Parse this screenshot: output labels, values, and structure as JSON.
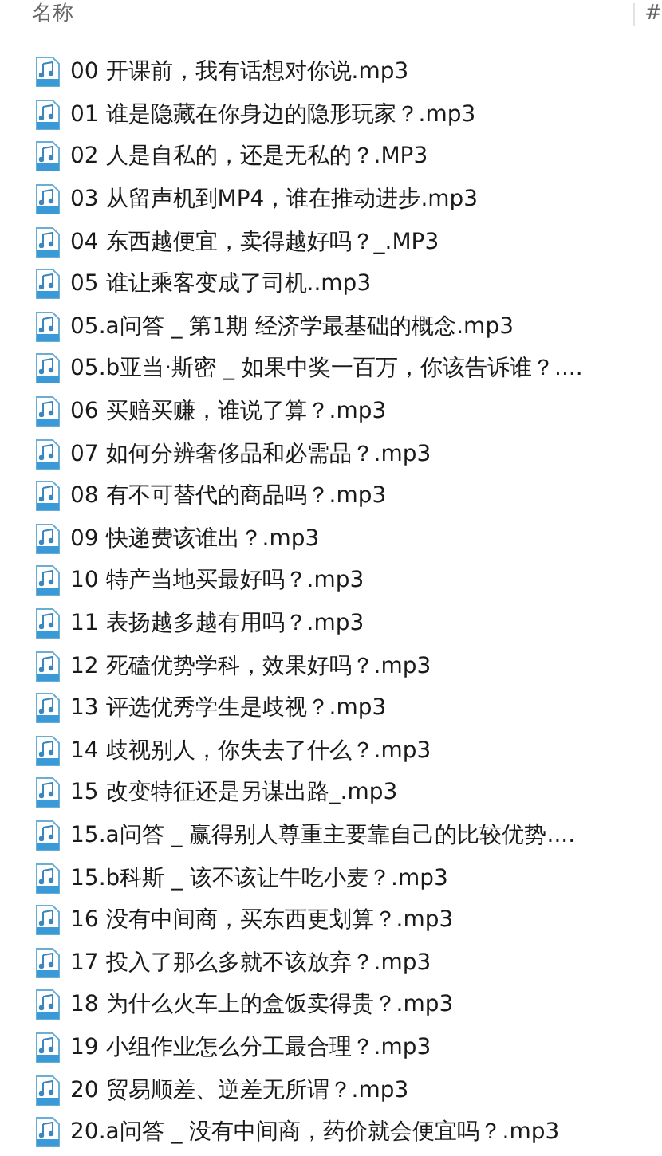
{
  "columns": [
    "名称",
    "#"
  ],
  "files": [
    {
      "name": "00 开课前，我有话想对你说.mp3"
    },
    {
      "name": "01 谁是隐藏在你身边的隐形玩家？.mp3"
    },
    {
      "name": "02 人是自私的，还是无私的？.MP3"
    },
    {
      "name": "03 从留声机到MP4，谁在推动进步.mp3"
    },
    {
      "name": "04 东西越便宜，卖得越好吗？_.MP3"
    },
    {
      "name": "05 谁让乘客变成了司机..mp3"
    },
    {
      "name": "05.a问答 _ 第1期 经济学最基础的概念.mp3"
    },
    {
      "name": "05.b亚当·斯密 _ 如果中奖一百万，你该告诉谁？...."
    },
    {
      "name": "06 买赔买赚，谁说了算？.mp3"
    },
    {
      "name": "07 如何分辨奢侈品和必需品？.mp3"
    },
    {
      "name": "08 有不可替代的商品吗？.mp3"
    },
    {
      "name": "09 快递费该谁出？.mp3"
    },
    {
      "name": "10 特产当地买最好吗？.mp3"
    },
    {
      "name": "11 表扬越多越有用吗？.mp3"
    },
    {
      "name": "12 死磕优势学科，效果好吗？.mp3"
    },
    {
      "name": "13 评选优秀学生是歧视？.mp3"
    },
    {
      "name": "14 歧视别人，你失去了什么？.mp3"
    },
    {
      "name": "15 改变特征还是另谋出路_.mp3"
    },
    {
      "name": "15.a问答 _ 赢得别人尊重主要靠自己的比较优势...."
    },
    {
      "name": "15.b科斯 _ 该不该让牛吃小麦？.mp3"
    },
    {
      "name": "16 没有中间商，买东西更划算？.mp3"
    },
    {
      "name": "17 投入了那么多就不该放弃？.mp3"
    },
    {
      "name": "18 为什么火车上的盒饭卖得贵？.mp3"
    },
    {
      "name": "19 小组作业怎么分工最合理？.mp3"
    },
    {
      "name": "20 贸易顺差、逆差无所谓？.mp3"
    },
    {
      "name": "20.a问答 _ 没有中间商，药价就会便宜吗？.mp3"
    }
  ]
}
